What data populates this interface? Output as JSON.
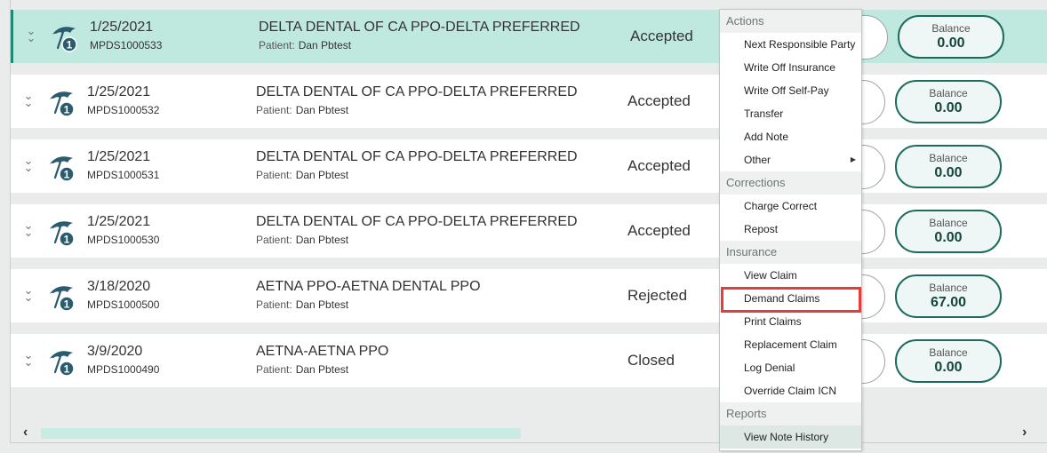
{
  "rows": [
    {
      "date": "1/25/2021",
      "code": "MPDS1000533",
      "payer": "DELTA DENTAL OF CA PPO-DELTA PREFERRED",
      "patient_label": "Patient:",
      "patient_name": "Dan Pbtest",
      "status": "Accepted",
      "balance_label": "Balance",
      "balance": "0.00"
    },
    {
      "date": "1/25/2021",
      "code": "MPDS1000532",
      "payer": "DELTA DENTAL OF CA PPO-DELTA PREFERRED",
      "patient_label": "Patient:",
      "patient_name": "Dan Pbtest",
      "status": "Accepted",
      "balance_label": "Balance",
      "balance": "0.00"
    },
    {
      "date": "1/25/2021",
      "code": "MPDS1000531",
      "payer": "DELTA DENTAL OF CA PPO-DELTA PREFERRED",
      "patient_label": "Patient:",
      "patient_name": "Dan Pbtest",
      "status": "Accepted",
      "balance_label": "Balance",
      "balance": "0.00"
    },
    {
      "date": "1/25/2021",
      "code": "MPDS1000530",
      "payer": "DELTA DENTAL OF CA PPO-DELTA PREFERRED",
      "patient_label": "Patient:",
      "patient_name": "Dan Pbtest",
      "status": "Accepted",
      "balance_label": "Balance",
      "balance": "0.00"
    },
    {
      "date": "3/18/2020",
      "code": "MPDS1000500",
      "payer": "AETNA PPO-AETNA DENTAL PPO",
      "patient_label": "Patient:",
      "patient_name": "Dan Pbtest",
      "status": "Rejected",
      "balance_label": "Balance",
      "balance": "67.00"
    },
    {
      "date": "3/9/2020",
      "code": "MPDS1000490",
      "payer": "AETNA-AETNA PPO",
      "patient_label": "Patient:",
      "patient_name": "Dan Pbtest",
      "status": "Closed",
      "balance_label": "Balance",
      "balance": "0.00"
    }
  ],
  "insurance_badge": "1",
  "scroll": {
    "left": "‹",
    "right": "›"
  },
  "menu": {
    "sections": [
      {
        "title": "Actions",
        "items": [
          "Next Responsible Party",
          "Write Off Insurance",
          "Write Off Self-Pay",
          "Transfer",
          "Add Note",
          "Other"
        ]
      },
      {
        "title": "Corrections",
        "items": [
          "Charge Correct",
          "Repost"
        ]
      },
      {
        "title": "Insurance",
        "items": [
          "View Claim",
          "Demand Claims",
          "Print Claims",
          "Replacement Claim",
          "Log Denial",
          "Override Claim ICN"
        ]
      },
      {
        "title": "Reports",
        "items": [
          "View Note History"
        ]
      }
    ],
    "highlighted": "Demand Claims",
    "hovered": "View Note History",
    "submenu_item": "Other"
  },
  "colors": {
    "selected_row": "#bfe9df",
    "accent": "#1e8a74",
    "highlight_box": "#e53c3c",
    "icon": "#2b5b6e"
  }
}
